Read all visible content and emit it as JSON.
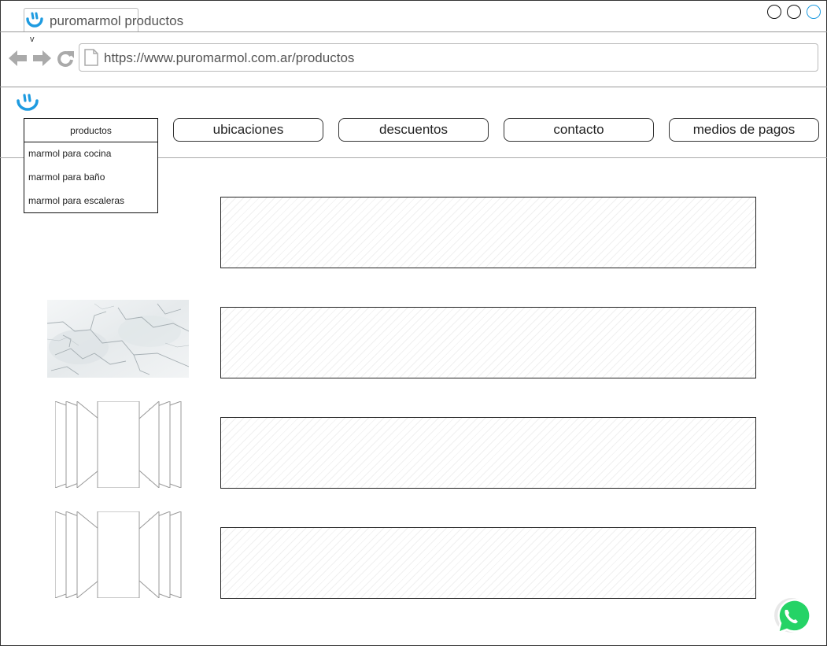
{
  "browser": {
    "tab_title": "puromarmol productos",
    "tab_marker": "v",
    "url": "https://www.puromarmol.com.ar/productos"
  },
  "nav": {
    "dropdown": {
      "label": "productos",
      "items": [
        "marmol para cocina",
        "marmol para baño",
        "marmol para escaleras"
      ]
    },
    "buttons": [
      "ubicaciones",
      "descuentos",
      "contacto",
      "medios de pagos"
    ]
  },
  "colors": {
    "brand_blue": "#1E9BE0",
    "whatsapp_green": "#25D366"
  },
  "icons": {
    "logo": "smiley-logo-icon",
    "back": "arrow-left-icon",
    "forward": "arrow-right-icon",
    "reload": "reload-icon",
    "page": "page-icon",
    "whatsapp": "whatsapp-icon"
  }
}
